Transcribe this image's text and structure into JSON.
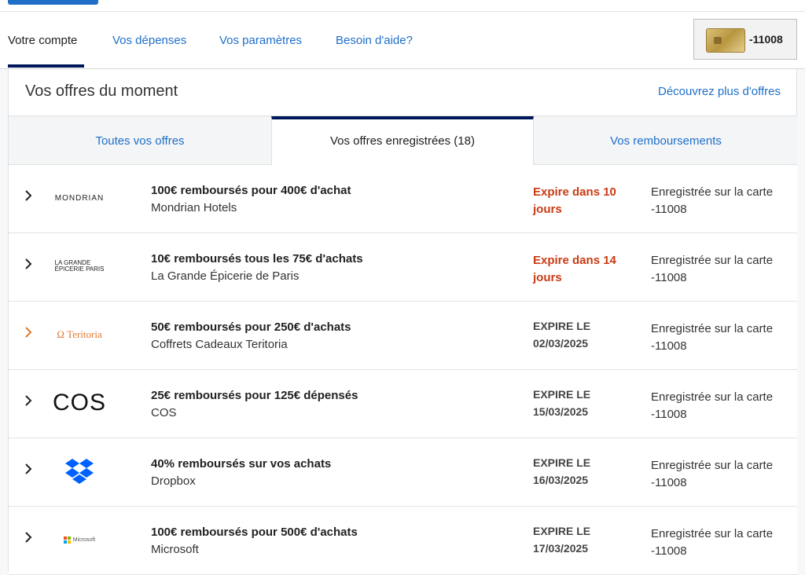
{
  "nav": {
    "items": [
      {
        "label": "Votre compte",
        "active": true
      },
      {
        "label": "Vos dépenses",
        "active": false
      },
      {
        "label": "Vos paramètres",
        "active": false
      },
      {
        "label": "Besoin d'aide?",
        "active": false
      }
    ],
    "card_number": "-11008"
  },
  "panel": {
    "title": "Vos offres du moment",
    "discover_link": "Découvrez plus d'offres"
  },
  "tabs": [
    {
      "label": "Toutes vos offres",
      "active": false
    },
    {
      "label": "Vos offres enregistrées (18)",
      "active": true
    },
    {
      "label": "Vos remboursements",
      "active": false
    }
  ],
  "offers": [
    {
      "logo": "mondrian-logo",
      "logo_text": "MONDRIAN",
      "title": "100€ remboursés pour 400€ d'achat",
      "merchant": "Mondrian Hotels",
      "expiry_line1": "Expire dans 10",
      "expiry_line2": "jours",
      "urgent": true,
      "registered_line1": "Enregistrée sur la carte",
      "registered_line2": "-11008"
    },
    {
      "logo": "grande-epicerie-logo",
      "logo_text_1": "LA GRANDE",
      "logo_text_2": "ÉPICERIE PARIS",
      "title": "10€ remboursés tous les 75€ d'achats",
      "merchant": "La Grande Épicerie de Paris",
      "expiry_line1": "Expire dans 14",
      "expiry_line2": "jours",
      "urgent": true,
      "registered_line1": "Enregistrée sur la carte",
      "registered_line2": "-11008"
    },
    {
      "logo": "teritoria-logo",
      "logo_text": "Ω Teritoria",
      "title": "50€ remboursés pour 250€ d'achats",
      "merchant": "Coffrets Cadeaux Teritoria",
      "expiry_line1": "EXPIRE LE",
      "expiry_line2": "02/03/2025",
      "urgent": false,
      "registered_line1": "Enregistrée sur la carte",
      "registered_line2": "-11008"
    },
    {
      "logo": "cos-logo",
      "logo_text": "COS",
      "title": "25€ remboursés pour 125€ dépensés",
      "merchant": "COS",
      "expiry_line1": "EXPIRE LE",
      "expiry_line2": "15/03/2025",
      "urgent": false,
      "registered_line1": "Enregistrée sur la carte",
      "registered_line2": "-11008"
    },
    {
      "logo": "dropbox-logo",
      "title": "40% remboursés sur vos achats",
      "merchant": "Dropbox",
      "expiry_line1": "EXPIRE LE",
      "expiry_line2": "16/03/2025",
      "urgent": false,
      "registered_line1": "Enregistrée sur la carte",
      "registered_line2": "-11008"
    },
    {
      "logo": "microsoft-logo",
      "logo_text": "Microsoft",
      "title": "100€ remboursés pour 500€ d'achats",
      "merchant": "Microsoft",
      "expiry_line1": "EXPIRE LE",
      "expiry_line2": "17/03/2025",
      "urgent": false,
      "registered_line1": "Enregistrée sur la carte",
      "registered_line2": "-11008"
    }
  ],
  "colors": {
    "link": "#1f6fc9",
    "urgent": "#c83b13",
    "navy": "#00175a"
  }
}
